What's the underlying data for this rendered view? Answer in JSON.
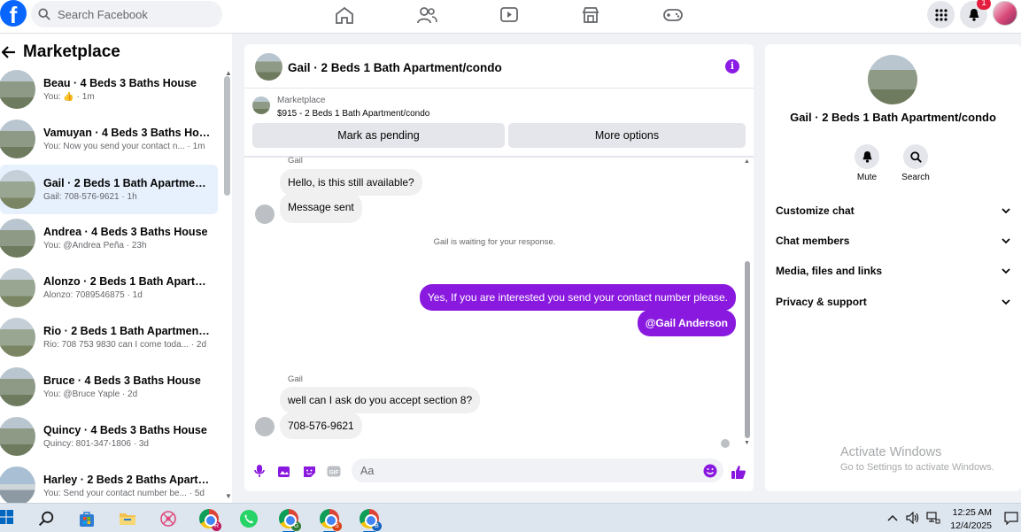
{
  "topbar": {
    "logo": "f",
    "search_placeholder": "Search Facebook",
    "notification_count": "1",
    "nav_icons": [
      "home-icon",
      "friends-icon",
      "video-icon",
      "marketplace-icon",
      "gaming-icon"
    ]
  },
  "sidebar": {
    "title": "Marketplace",
    "items": [
      {
        "title": "Beau · 4 Beds 3 Baths House",
        "subtitle": "You: 👍 · 1m"
      },
      {
        "title": "Vamuyan · 4 Beds 3 Baths House",
        "subtitle": "You: Now you send your contact n... · 1m"
      },
      {
        "title": "Gail · 2 Beds 1 Bath Apartment/c...",
        "subtitle": "Gail: 708-576-9621 · 1h"
      },
      {
        "title": "Andrea · 4 Beds 3 Baths House",
        "subtitle": "You: @Andrea Peña · 23h"
      },
      {
        "title": "Alonzo · 2 Beds 1 Bath Apartme...",
        "subtitle": "Alonzo: 7089546875 · 1d"
      },
      {
        "title": "Rio · 2 Beds 1 Bath Apartment/c...",
        "subtitle": "Rio: 708 753 9830 can I come toda... · 2d"
      },
      {
        "title": "Bruce · 4 Beds 3 Baths House",
        "subtitle": "You: @Bruce Yaple · 2d"
      },
      {
        "title": "Quincy · 4 Beds 3 Baths House",
        "subtitle": "Quincy: 801-347-1806 · 3d"
      },
      {
        "title": "Harley · 2 Beds 2 Baths Apartme...",
        "subtitle": "You: Send your contact number be... · 5d"
      }
    ]
  },
  "chat": {
    "title": "Gail · 2 Beds 1 Bath Apartment/condo",
    "marketplace_label": "Marketplace",
    "listing": "$915 - 2 Beds 1 Bath Apartment/condo",
    "mark_pending": "Mark as pending",
    "more_options": "More options",
    "sender": "Gail",
    "msg1": "Hello, is this still available?",
    "msg2": "Message sent",
    "system": "Gail is waiting for your response.",
    "out1": "Yes, If you are interested you send your contact number please.",
    "out2": "@Gail Anderson",
    "sender2": "Gail",
    "msg3": "well can I ask do you accept section 8?",
    "msg4": "708-576-9621",
    "composer_placeholder": "Aa"
  },
  "details": {
    "title": "Gail · 2 Beds 1 Bath Apartment/condo",
    "mute": "Mute",
    "search": "Search",
    "sections": [
      "Customize chat",
      "Chat members",
      "Media, files and links",
      "Privacy & support"
    ]
  },
  "watermark": {
    "line1": "Activate Windows",
    "line2": "Go to Settings to activate Windows."
  },
  "taskbar": {
    "time": "12:25 AM",
    "date": "12/4/2025"
  },
  "colors": {
    "accent": "#8a19e0",
    "facebook_blue": "#0866ff"
  }
}
